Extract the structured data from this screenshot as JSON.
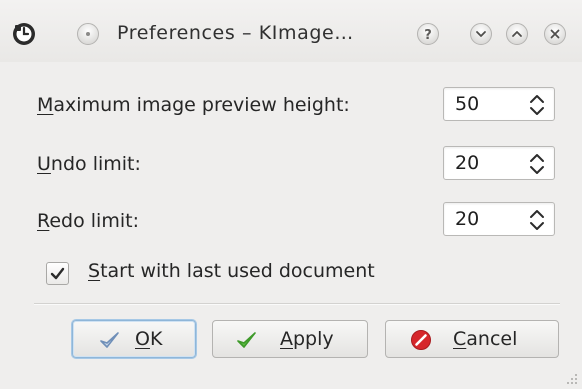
{
  "window": {
    "title": "Preferences – KImage…"
  },
  "titlebar": {
    "app_icon": "kimage-app-icon",
    "buttons": [
      {
        "name": "menu",
        "icon": "circle-dot-icon"
      },
      {
        "name": "help",
        "label": "?"
      },
      {
        "name": "minimize",
        "icon": "chevron-down-icon"
      },
      {
        "name": "maximize",
        "icon": "chevron-up-icon"
      },
      {
        "name": "close",
        "icon": "close-icon"
      }
    ]
  },
  "form": {
    "preview_height": {
      "mnemonic": "M",
      "label_rest": "aximum image preview height:",
      "value": "50"
    },
    "undo_limit": {
      "mnemonic": "U",
      "label_rest": "ndo limit:",
      "value": "20"
    },
    "redo_limit": {
      "mnemonic": "R",
      "label_rest": "edo limit:",
      "value": "20"
    },
    "start_with_last": {
      "checked": true,
      "mnemonic": "S",
      "label_rest": "tart with last used document"
    }
  },
  "buttons": {
    "ok": {
      "mnemonic": "O",
      "label_rest": "K",
      "icon": "check-icon"
    },
    "apply": {
      "mnemonic": "A",
      "label_rest": "pply",
      "icon": "check-icon"
    },
    "cancel": {
      "mnemonic": "C",
      "label_rest": "ancel",
      "icon": "cancel-icon"
    }
  },
  "colors": {
    "window_bg": "#efeeed",
    "focus_blue": "#8fb6d8",
    "check_blue": "#6f8fb8",
    "check_green": "#3e9a2a",
    "cancel_red": "#d6262b"
  }
}
